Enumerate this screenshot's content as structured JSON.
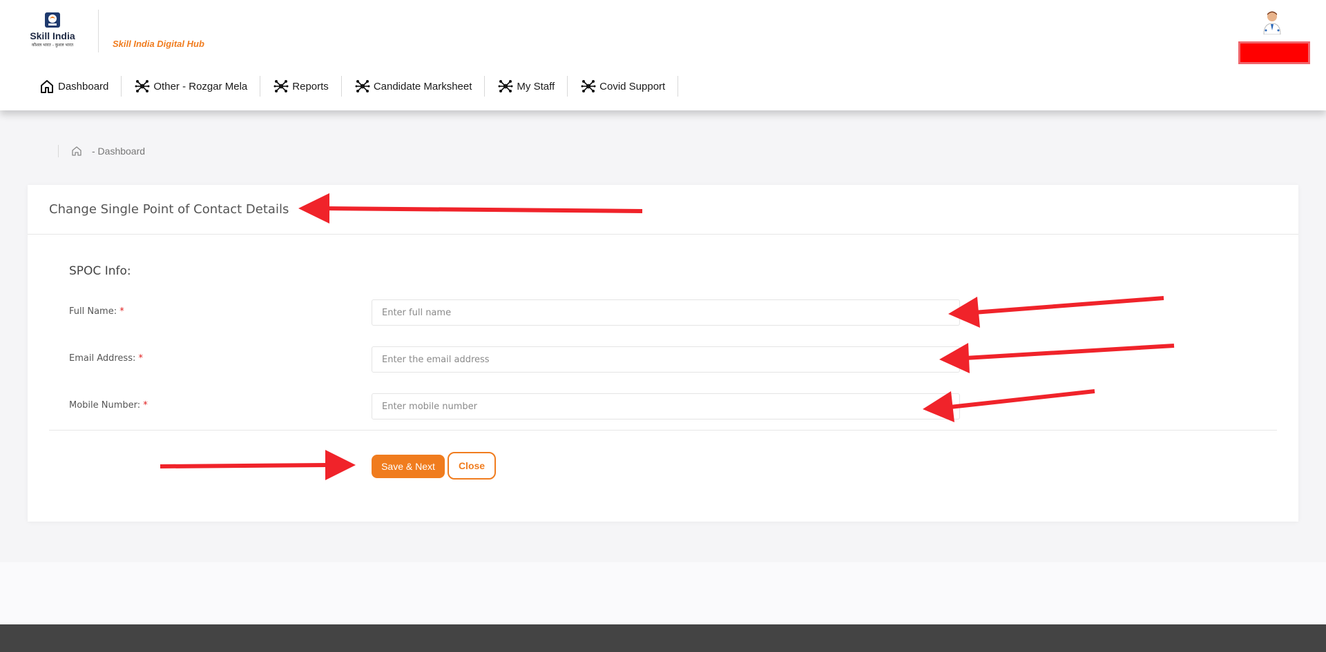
{
  "header": {
    "logo": {
      "brand": "Skill India",
      "tagline": "कौशल भारत - कुशल भारत"
    },
    "hub_title": "Skill India Digital Hub",
    "user_redacted_color": "#ff0000"
  },
  "nav": {
    "items": [
      {
        "label": "Dashboard",
        "icon": "home-icon"
      },
      {
        "label": "Other - Rozgar Mela",
        "icon": "network-icon"
      },
      {
        "label": "Reports",
        "icon": "network-icon"
      },
      {
        "label": "Candidate Marksheet",
        "icon": "network-icon"
      },
      {
        "label": "My Staff",
        "icon": "network-icon"
      },
      {
        "label": "Covid Support",
        "icon": "network-icon"
      }
    ]
  },
  "breadcrumb": {
    "home_icon": "home-icon",
    "label": "- Dashboard"
  },
  "card": {
    "title": "Change Single Point of Contact Details",
    "section_title": "SPOC Info:",
    "fields": [
      {
        "label": "Full Name:",
        "required_mark": "*",
        "placeholder": "Enter full name",
        "value": ""
      },
      {
        "label": "Email Address:",
        "required_mark": "*",
        "placeholder": "Enter the email address",
        "value": ""
      },
      {
        "label": "Mobile Number:",
        "required_mark": "*",
        "placeholder": "Enter mobile number",
        "value": ""
      }
    ],
    "buttons": {
      "save_label": "Save & Next",
      "close_label": "Close"
    }
  },
  "colors": {
    "accent": "#f07c1e",
    "annotation_arrows": "#f0232a",
    "footer": "#444444"
  }
}
